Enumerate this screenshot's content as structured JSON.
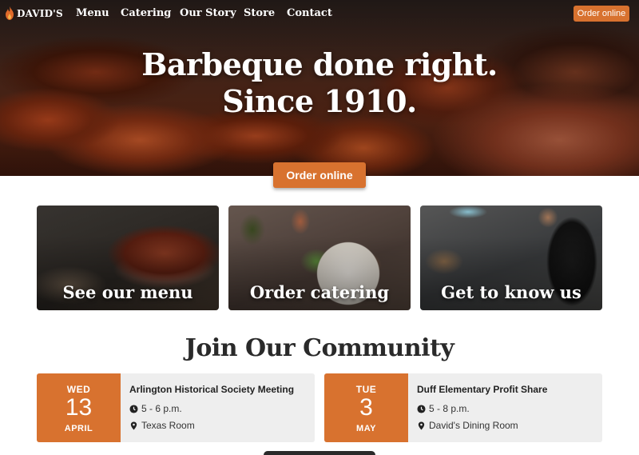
{
  "nav": {
    "brand": "DAVID'S",
    "links": [
      "Menu",
      "Catering",
      "Our Story",
      "Store",
      "Contact"
    ],
    "order_button": "Order online"
  },
  "hero": {
    "title_line1": "Barbeque done right.",
    "title_line2": "Since 1910.",
    "cta": "Order online"
  },
  "cards": [
    {
      "label": "See our menu"
    },
    {
      "label": "Order catering"
    },
    {
      "label": "Get to know us"
    }
  ],
  "community": {
    "title": "Join Our Community",
    "events": [
      {
        "dow": "WED",
        "day": "13",
        "month": "APRIL",
        "title": "Arlington Historical Society Meeting",
        "time": "5 - 6 p.m.",
        "location": "Texas Room"
      },
      {
        "dow": "TUE",
        "day": "3",
        "month": "MAY",
        "title": "Duff Elementary Profit Share",
        "time": "5 - 8 p.m.",
        "location": "David's Dining Room"
      }
    ]
  },
  "icons": {
    "logo": "flame-icon",
    "time": "clock-icon",
    "location": "map-pin-icon"
  },
  "colors": {
    "accent": "#d8722f",
    "event_bg": "#eeeeee",
    "title_text": "#2a2a2a"
  }
}
